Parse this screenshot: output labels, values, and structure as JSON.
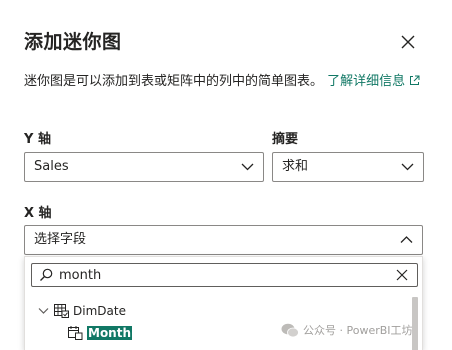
{
  "dialog": {
    "title": "添加迷你图",
    "description": "迷你图是可以添加到表或矩阵中的列中的简单图表。",
    "learn_more": "了解详细信息",
    "y_axis_label": "Y 轴",
    "y_axis_value": "Sales",
    "summary_label": "摘要",
    "summary_value": "求和",
    "x_axis_label": "X 轴",
    "x_axis_placeholder": "选择字段"
  },
  "dropdown": {
    "search_value": "month",
    "tree": {
      "table_name": "DimDate",
      "field_name": "Month"
    }
  },
  "watermark": {
    "text": "公众号 · PowerBI工坊"
  },
  "colors": {
    "accent": "#117865",
    "border": "#8a8886",
    "text": "#252423"
  }
}
